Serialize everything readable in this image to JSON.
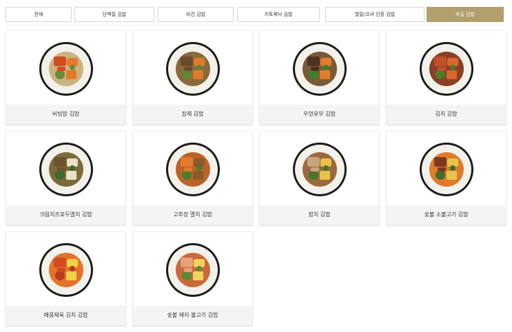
{
  "tabs": [
    {
      "label": "전체",
      "active": false
    },
    {
      "label": "단백질 김밥",
      "active": false
    },
    {
      "label": "비건 김밥",
      "active": false
    },
    {
      "label": "키토제닉 김밥",
      "active": false
    },
    {
      "label": "할랄/코셔 인증 김밥",
      "active": false
    },
    {
      "label": "추출 김밥",
      "active": true
    }
  ],
  "products": [
    {
      "name": "비빔밥 김밥",
      "image": "gimbap-roll-image",
      "fill": [
        "#d24c1f",
        "#e8792a",
        "#6a8b3a",
        "#c9b480"
      ]
    },
    {
      "name": "잡채 김밥",
      "image": "gimbap-roll-image",
      "fill": [
        "#6b4a2a",
        "#e07a2c",
        "#5d8a2f",
        "#8a6a3a"
      ]
    },
    {
      "name": "우엉유부 김밥",
      "image": "gimbap-roll-image",
      "fill": [
        "#4a3322",
        "#e37b2a",
        "#3f7f2e",
        "#7a5a36"
      ]
    },
    {
      "name": "김치 김밥",
      "image": "gimbap-roll-image",
      "fill": [
        "#c0502a",
        "#d9662d",
        "#4d7a2b",
        "#8a4024"
      ]
    },
    {
      "name": "크림치즈호두멸치 김밥",
      "image": "gimbap-roll-image",
      "fill": [
        "#6b5530",
        "#e8e2c8",
        "#3e6a2a",
        "#7d6a3a"
      ]
    },
    {
      "name": "고추장 멸치 김밥",
      "image": "gimbap-roll-image",
      "fill": [
        "#e07a2c",
        "#8a5a2a",
        "#4e7b2c",
        "#b8642a"
      ]
    },
    {
      "name": "참치 김밥",
      "image": "gimbap-roll-image",
      "fill": [
        "#c8a47a",
        "#e8c24a",
        "#46752c",
        "#9a6a3e"
      ]
    },
    {
      "name": "숯불 소불고기 김밥",
      "image": "gimbap-roll-image",
      "fill": [
        "#7a3a20",
        "#e8c44a",
        "#3f6f2a",
        "#e07a2c"
      ]
    },
    {
      "name": "매콤제육 김치 김밥",
      "image": "gimbap-roll-image",
      "fill": [
        "#d04a22",
        "#f2d04a",
        "#b83a1e",
        "#e2742a"
      ]
    },
    {
      "name": "숯불 돼지 불고기 김밥",
      "image": "gimbap-roll-image",
      "fill": [
        "#e8a07a",
        "#f0d260",
        "#5a8a32",
        "#c86a3a"
      ]
    }
  ],
  "colors": {
    "accent": "#b39e6e",
    "laver": "#1b1b1b",
    "rice": "#f3f1ec"
  }
}
